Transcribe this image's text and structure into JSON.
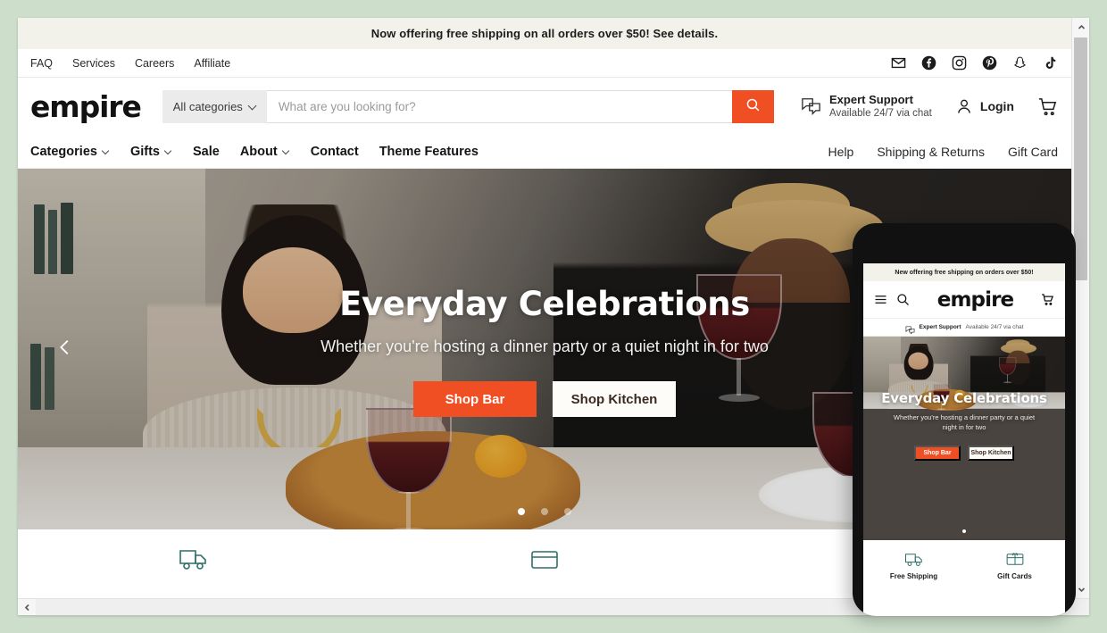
{
  "announcement": {
    "text": "Now offering free shipping on all orders over $50! See details."
  },
  "utility": {
    "links": [
      {
        "label": "FAQ"
      },
      {
        "label": "Services"
      },
      {
        "label": "Careers"
      },
      {
        "label": "Affiliate"
      }
    ],
    "social": [
      {
        "name": "email-icon"
      },
      {
        "name": "facebook-icon"
      },
      {
        "name": "instagram-icon"
      },
      {
        "name": "pinterest-icon"
      },
      {
        "name": "snapchat-icon"
      },
      {
        "name": "tiktok-icon"
      }
    ]
  },
  "header": {
    "logo": "empire",
    "category_select": "All categories",
    "search_placeholder": "What are you looking for?",
    "search_value": "",
    "support_title": "Expert Support",
    "support_sub": "Available 24/7 via chat",
    "login_label": "Login",
    "cart_icon": "cart-icon",
    "search_icon": "search-icon"
  },
  "nav": {
    "left": [
      {
        "label": "Categories",
        "caret": true
      },
      {
        "label": "Gifts",
        "caret": true
      },
      {
        "label": "Sale",
        "caret": false
      },
      {
        "label": "About",
        "caret": true
      },
      {
        "label": "Contact",
        "caret": false
      },
      {
        "label": "Theme Features",
        "caret": false
      }
    ],
    "right": [
      {
        "label": "Help"
      },
      {
        "label": "Shipping & Returns"
      },
      {
        "label": "Gift Card"
      }
    ]
  },
  "hero": {
    "title": "Everyday Celebrations",
    "subtitle": "Whether you're hosting a dinner party or a quiet night in for two",
    "primary_button": "Shop Bar",
    "secondary_button": "Shop Kitchen",
    "slides_total": 3,
    "active_slide": 1,
    "prev_arrow": "chevron-left-icon"
  },
  "mobile": {
    "announcement": "New offering free shipping on orders over $50!",
    "logo": "empire",
    "menu_icon": "hamburger-menu-icon",
    "search_icon": "search-icon",
    "cart_icon": "cart-icon",
    "support_title": "Expert Support",
    "support_sub": "Available 24/7 via chat",
    "hero_title": "Everyday Celebrations",
    "hero_subtitle": "Whether you're hosting a dinner party or a quiet night in for two",
    "primary_button": "Shop Bar",
    "secondary_button": "Shop Kitchen",
    "props": [
      {
        "label": "Free Shipping",
        "icon": "shipping-truck-icon"
      },
      {
        "label": "Gift Cards",
        "icon": "gift-card-icon"
      }
    ]
  },
  "colors": {
    "accent": "#f04e23",
    "announcement_bg": "#f2f2ea",
    "page_bg": "#cddecb",
    "prop_icon": "#2f6f68"
  }
}
